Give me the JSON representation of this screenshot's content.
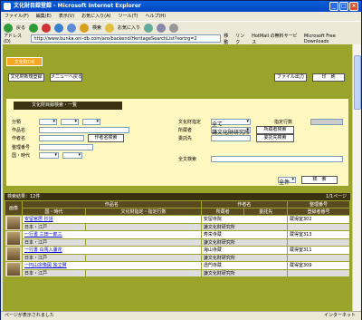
{
  "window": {
    "title": "文化財目録登録 - Microsoft Internet Explorer",
    "min": "_",
    "max": "□",
    "close": "×"
  },
  "menu": [
    "ファイル(F)",
    "編集(E)",
    "表示(V)",
    "お気に入り(A)",
    "ツール(T)",
    "ヘルプ(H)"
  ],
  "toolbar": {
    "back": "戻る",
    "search": "検索",
    "favorites": "お気に入り"
  },
  "address": {
    "label": "アドレス(D)",
    "url": "http://www.bunka.oni-db.com/aro/backend/HeritageSearchList?sortrg=2",
    "go": "移動",
    "links": "リンク",
    "link1": "HotMail の無料サービス",
    "link2": "Microsoft Free Downloads"
  },
  "page": {
    "header_tab": "文化財DB",
    "new_register": "文化財新規登録",
    "menu_back": "メニューへ戻る",
    "file_output": "ファイル出力",
    "print": "印　刷",
    "form_title": "文化財目録検索・一覧",
    "labels": {
      "category": "分類",
      "title": "作品名",
      "author": "作者名",
      "collection_no": "整理番号",
      "country_era": "国・時代",
      "designation": "文化財指定",
      "owner": "所蔵者",
      "custodian": "委託先",
      "keyword": "全文検索",
      "record_count": "指定行数"
    },
    "author_search_btn": "作者名検索",
    "owner_value": "謙文化財研究所",
    "owner_search_btn": "所蔵者検索",
    "custodian_search_btn": "委託先検索",
    "designation_value": "全て",
    "sort_value": "全件",
    "search_btn": "検　索",
    "result_count": "検索結果：12件",
    "page_indicator": "1/1ページ",
    "columns": {
      "image": "画像",
      "title": "作品名",
      "country_era": "国・時代",
      "designation": "文化財指定・指定行数",
      "owner": "所蔵者",
      "author": "作者名",
      "custodian": "委託先",
      "collection_no": "整理番号",
      "edit": "登録者番号"
    },
    "rows": [
      {
        "title": "安留宮居 抄話",
        "era": "日本・江戸",
        "owner": "安留寺院",
        "custodian": "謙文化財研究所",
        "no": "蔵得室302"
      },
      {
        "title": "一行書 三田一郎三",
        "era": "日本・江戸",
        "owner": "寿栄寺蔵",
        "custodian": "謙文化財研究所",
        "no": "蔵得室313"
      },
      {
        "title": "一行書 白馬入蘆花",
        "era": "日本・江戸",
        "owner": "海山寺蔵",
        "custodian": "謙文化財研究所",
        "no": "蔵得室311"
      },
      {
        "title": "一円山宗像図 独立賛",
        "era": "日本・江戸",
        "owner": "透門寺蔵",
        "custodian": "謙文化財研究所",
        "no": "蔵得室309"
      }
    ]
  },
  "status": {
    "text": "ページが表示されました",
    "zone": "インターネット"
  }
}
